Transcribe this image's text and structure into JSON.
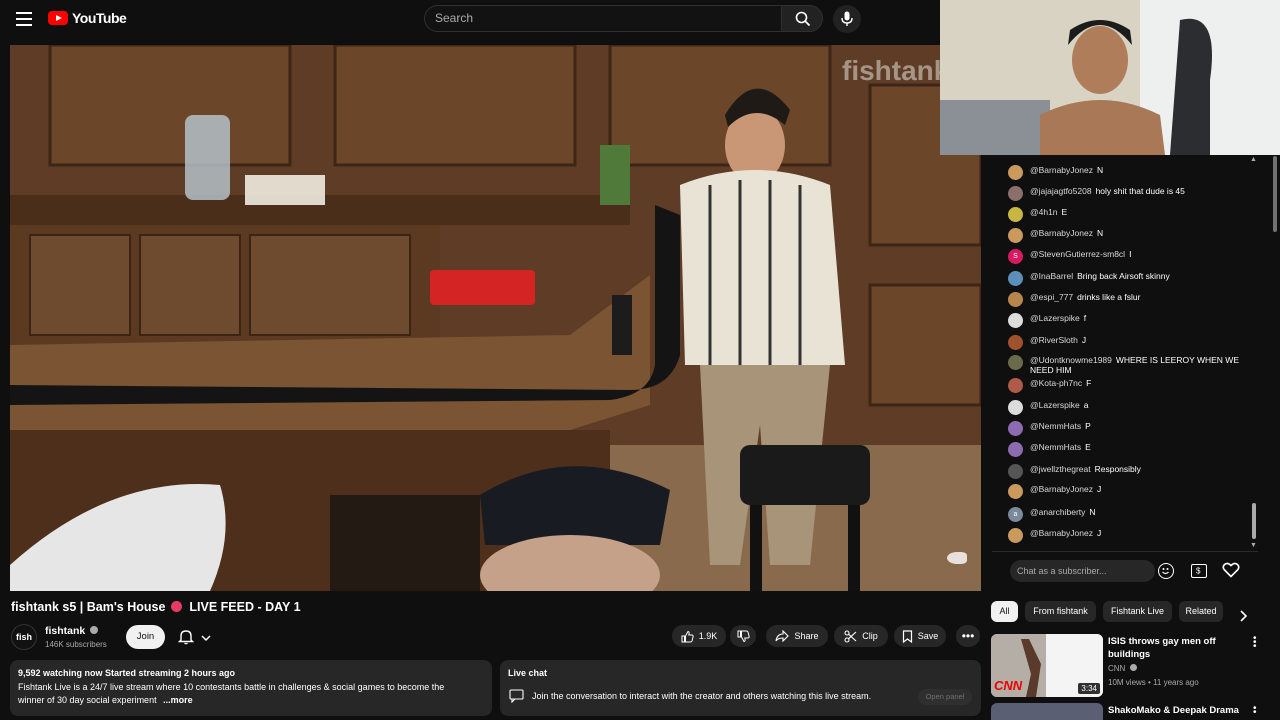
{
  "header": {
    "brand": "YouTube",
    "search_placeholder": "Search"
  },
  "video": {
    "watermark": "fishtank"
  },
  "chat": {
    "messages": [
      {
        "author": "@BarnabyJonez",
        "text": "N",
        "color": "#c99a5b"
      },
      {
        "author": "@jajajagtfo5208",
        "text": "holy shit that dude is 45",
        "color": "#8b6f6a"
      },
      {
        "author": "@4h1n",
        "text": "E",
        "color": "#c9b640"
      },
      {
        "author": "@BarnabyJonez",
        "text": "N",
        "color": "#c99a5b"
      },
      {
        "author": "@StevenGutierrez-sm8cl",
        "text": "I",
        "color": "#d81b60",
        "initial": "S"
      },
      {
        "author": "@InaBarrel",
        "text": "Bring back Airsoft skinny",
        "color": "#5b8fb9"
      },
      {
        "author": "@espi_777",
        "text": "drinks like a fslur",
        "color": "#b8864b"
      },
      {
        "author": "@Lazerspike",
        "text": "f",
        "color": "#dcdcdc"
      },
      {
        "author": "@RiverSloth",
        "text": "J",
        "color": "#a0522d"
      },
      {
        "author": "@Udontknowme1989",
        "text": "WHERE IS LEEROY WHEN WE NEED HIM",
        "color": "#6b6b4b"
      },
      {
        "author": "@Kota-ph7nc",
        "text": "F",
        "color": "#b05a4a"
      },
      {
        "author": "@Lazerspike",
        "text": "a",
        "color": "#dcdcdc"
      },
      {
        "author": "@NemmHats",
        "text": "P",
        "color": "#8c6bb1"
      },
      {
        "author": "@NemmHats",
        "text": "E",
        "color": "#8c6bb1"
      },
      {
        "author": "@jwellzthegreat",
        "text": "Responsibly",
        "color": "#555555"
      },
      {
        "author": "@BarnabyJonez",
        "text": "J",
        "color": "#c99a5b"
      },
      {
        "author": "@anarchiberty",
        "text": "N",
        "color": "#7a8a9a",
        "initial": "a"
      },
      {
        "author": "@BarnabyJonez",
        "text": "J",
        "color": "#c99a5b"
      }
    ],
    "input_placeholder": "Chat as a subscriber..."
  },
  "video_info": {
    "title_main": "fishtank s5 | Bam's House",
    "title_live": "LIVE FEED - DAY 1",
    "channel_name": "fishtank",
    "channel_avatar_text": "fish",
    "subscribers": "146K subscribers",
    "join_label": "Join",
    "likes": "1.9K",
    "share_label": "Share",
    "clip_label": "Clip",
    "save_label": "Save"
  },
  "description": {
    "stats": "9,592 watching now  Started streaming 2 hours ago",
    "line1": "Fishtank Live is a 24/7 live stream where 10 contestants battle in challenges & social games to become the",
    "line2": "winner of 30 day social experiment",
    "more": "...more"
  },
  "live_chat_panel": {
    "title": "Live chat",
    "text": "Join the conversation to interact with the creator and others watching this live stream.",
    "open_panel": "Open panel"
  },
  "chips": [
    "All",
    "From fishtank",
    "Fishtank Live",
    "Related"
  ],
  "related": [
    {
      "title_line1": "ISIS throws gay men off",
      "title_line2": "buildings",
      "channel": "CNN",
      "meta": "10M views • 11 years ago",
      "duration": "3:34",
      "thumb_label": "CNN"
    },
    {
      "title_line1": "ShakoMako & Deepak Drama"
    }
  ]
}
